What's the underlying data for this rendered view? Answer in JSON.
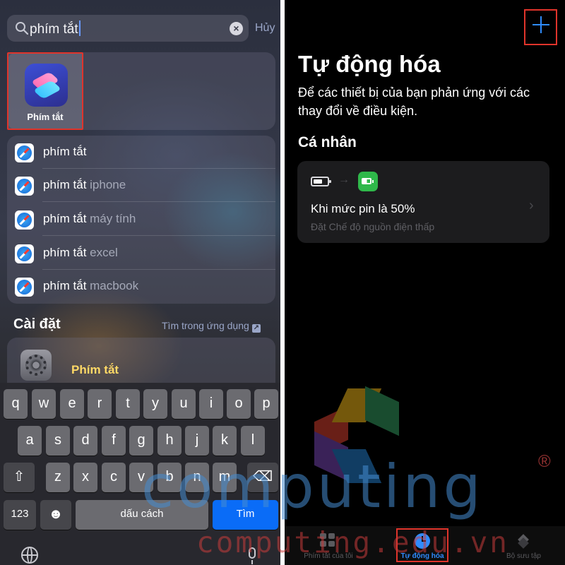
{
  "left": {
    "search": {
      "query": "phím tắt",
      "cancel_label": "Hủy"
    },
    "top_hit": {
      "label": "Phím tắt",
      "icon": "shortcuts-app-icon"
    },
    "suggestions": [
      {
        "main": "phím tắt",
        "rest": ""
      },
      {
        "main": "phím tắt",
        "rest": " iphone"
      },
      {
        "main": "phím tắt",
        "rest": " máy tính"
      },
      {
        "main": "phím tắt",
        "rest": " excel"
      },
      {
        "main": "phím tắt",
        "rest": " macbook"
      }
    ],
    "settings_section": {
      "title": "Cài đặt",
      "link": "Tìm trong ứng dụng",
      "result_label": "Phím tắt"
    },
    "keyboard": {
      "row1": [
        "q",
        "w",
        "e",
        "r",
        "t",
        "y",
        "u",
        "i",
        "o",
        "p"
      ],
      "row2": [
        "a",
        "s",
        "d",
        "f",
        "g",
        "h",
        "j",
        "k",
        "l"
      ],
      "row3": [
        "z",
        "x",
        "c",
        "v",
        "b",
        "n",
        "m"
      ],
      "numbers_label": "123",
      "space_label": "dấu cách",
      "go_label": "Tìm"
    }
  },
  "right": {
    "title": "Tự động hóa",
    "description": "Để các thiết bị của bạn phản ứng với các thay đổi về điều kiện.",
    "section": "Cá nhân",
    "automation": {
      "title": "Khi mức pin là 50%",
      "subtitle": "Đặt Chế độ nguồn điện thấp"
    },
    "tabs": [
      {
        "label": "Phím tắt của tôi",
        "icon": "grid-icon"
      },
      {
        "label": "Tự động hóa",
        "icon": "clock-icon",
        "active": true
      },
      {
        "label": "Bộ sưu tập",
        "icon": "stack-icon"
      }
    ]
  },
  "watermark": {
    "word": "computing",
    "url": "computing.edu.vn",
    "reg": "®"
  },
  "colors": {
    "accent_blue": "#2f8cff",
    "highlight_red": "#e0342b",
    "go_key": "#0a6cf7"
  }
}
